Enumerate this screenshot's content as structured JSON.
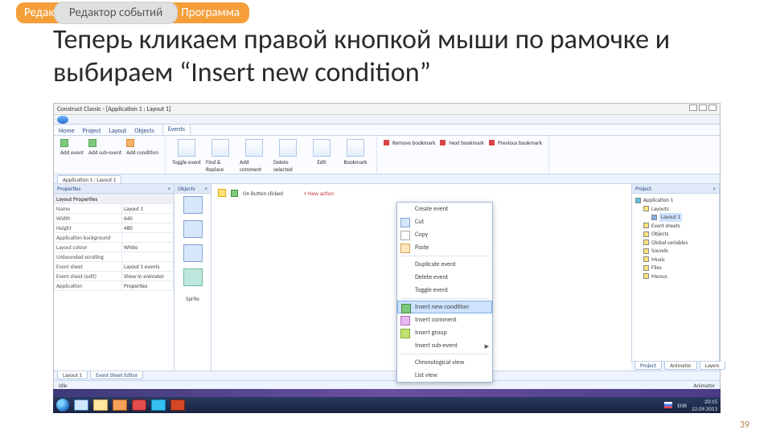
{
  "tabs": {
    "behind": "Редакто",
    "front": "Редактор событий",
    "after": "Программа"
  },
  "heading": "Теперь кликаем правой кнопкой мыши по рамочке и выбираем “Insert new condition”",
  "app_title": "Construct Classic - [Application 1 : Layout 1]",
  "ribbon_tabs": [
    "Home",
    "Project",
    "Layout",
    "Objects",
    "Events"
  ],
  "ribbon_left": {
    "add_event": "Add event",
    "add_sub": "Add sub-event",
    "add_cond": "Add condition"
  },
  "ribbon_center": [
    "Toggle event",
    "Find & Replace",
    "Add comment",
    "Delete selected",
    "Edit",
    "Bookmark"
  ],
  "bookmarks": {
    "remove": "Remove bookmark",
    "next": "Next bookmark",
    "prev": "Previous bookmark"
  },
  "doctab": "Application 1 : Layout 1",
  "properties": {
    "title": "Properties",
    "category": "Layout Properties",
    "rows": [
      [
        "Name",
        "Layout 1"
      ],
      [
        "Width",
        "640"
      ],
      [
        "Height",
        "480"
      ],
      [
        "Application background",
        ""
      ],
      [
        "Layout colour",
        "White"
      ],
      [
        "Unbounded scrolling",
        ""
      ],
      [
        "Event sheet",
        "Layout 1 events"
      ],
      [
        "Event sheet (edit)",
        "Show in animator"
      ],
      [
        "Application",
        "Properties"
      ]
    ]
  },
  "objects": {
    "title": "Objects",
    "footer": "Sprite"
  },
  "canvas": {
    "event_text": "On Button clicked",
    "add_action": "+ New action"
  },
  "context_menu": [
    {
      "label": "Create event"
    },
    {
      "label": "Cut",
      "icon": "cut"
    },
    {
      "label": "Copy",
      "icon": "copy"
    },
    {
      "label": "Paste",
      "icon": "paste"
    },
    {
      "sep": true
    },
    {
      "label": "Duplicate event"
    },
    {
      "label": "Delete event"
    },
    {
      "label": "Toggle event"
    },
    {
      "sep": true
    },
    {
      "label": "Insert new condition",
      "icon": "green",
      "selected": true
    },
    {
      "label": "Insert comment",
      "icon": "comment"
    },
    {
      "label": "Insert group",
      "icon": "group"
    },
    {
      "label": "Insert sub-event",
      "arrow": true
    },
    {
      "sep": true
    },
    {
      "label": "Chronological view"
    },
    {
      "label": "List view"
    }
  ],
  "project": {
    "title": "Project",
    "tree": [
      {
        "label": "Application 1",
        "cls": "app",
        "ind": 0
      },
      {
        "label": "Layouts",
        "cls": "y",
        "ind": 1
      },
      {
        "label": "Layout 1",
        "cls": "b",
        "ind": 2,
        "sel": true
      },
      {
        "label": "Event sheets",
        "cls": "y",
        "ind": 1
      },
      {
        "label": "Objects",
        "cls": "y",
        "ind": 1
      },
      {
        "label": "Global variables",
        "cls": "y",
        "ind": 1
      },
      {
        "label": "Sounds",
        "cls": "y",
        "ind": 1
      },
      {
        "label": "Music",
        "cls": "y",
        "ind": 1
      },
      {
        "label": "Files",
        "cls": "y",
        "ind": 1
      },
      {
        "label": "Menus",
        "cls": "y",
        "ind": 1
      }
    ],
    "tabs": [
      "Project",
      "Animator",
      "Layers"
    ]
  },
  "bottom": {
    "tabs": [
      "Layout 1",
      "Event Sheet Editor"
    ],
    "status_left": "Idle",
    "status_right": "Animator"
  },
  "tray": {
    "lang": "ENR",
    "time": "20:15",
    "date": "22.09.2013"
  },
  "page_number": "39"
}
